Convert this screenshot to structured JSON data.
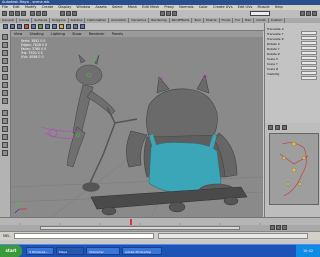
{
  "window": {
    "title": "Autodesk Maya - scene.mb"
  },
  "menubar": {
    "items": [
      "File",
      "Edit",
      "Modify",
      "Create",
      "Display",
      "Window",
      "Assets",
      "Select",
      "Mesh",
      "Edit Mesh",
      "Proxy",
      "Normals",
      "Color",
      "Create UVs",
      "Edit UVs",
      "Muscle",
      "Help"
    ]
  },
  "shelf": {
    "tabs": [
      "General",
      "Curves",
      "Surfaces",
      "Polygons",
      "Subdivs",
      "Deformation",
      "Animation",
      "Dynamics",
      "Rendering",
      "PaintEffects",
      "Toon",
      "Muscle",
      "Fluids",
      "Fur",
      "Hair",
      "nCloth",
      "Custom"
    ]
  },
  "viewport": {
    "menus": [
      "View",
      "Shading",
      "Lighting",
      "Show",
      "Renderer",
      "Panels"
    ],
    "hud": [
      {
        "label": "Verts:",
        "v1": "3892",
        "v2": "0",
        "v3": "0"
      },
      {
        "label": "Edges:",
        "v1": "7628",
        "v2": "0",
        "v3": "0"
      },
      {
        "label": "Faces:",
        "v1": "3760",
        "v2": "0",
        "v3": "0"
      },
      {
        "label": "Tris:",
        "v1": "7520",
        "v2": "0",
        "v3": "0"
      },
      {
        "label": "UVs:",
        "v1": "4098",
        "v2": "0",
        "v3": "0"
      }
    ]
  },
  "channelbox": {
    "rows": [
      "Translate X",
      "Translate Y",
      "Translate Z",
      "Rotate X",
      "Rotate Y",
      "Rotate Z",
      "Scale X",
      "Scale Y",
      "Scale Z",
      "Visibility"
    ]
  },
  "commandline": {
    "label": "MEL"
  },
  "taskbar": {
    "start": "start",
    "tasks": [
      "3 Windows...",
      "Maya",
      "Character",
      "Adobe Photoshop"
    ],
    "clock": "10:42"
  },
  "colors": {
    "taskbar": "#1e53b6",
    "viewport": "#8a8a8a",
    "start": "#3a9a3a"
  }
}
